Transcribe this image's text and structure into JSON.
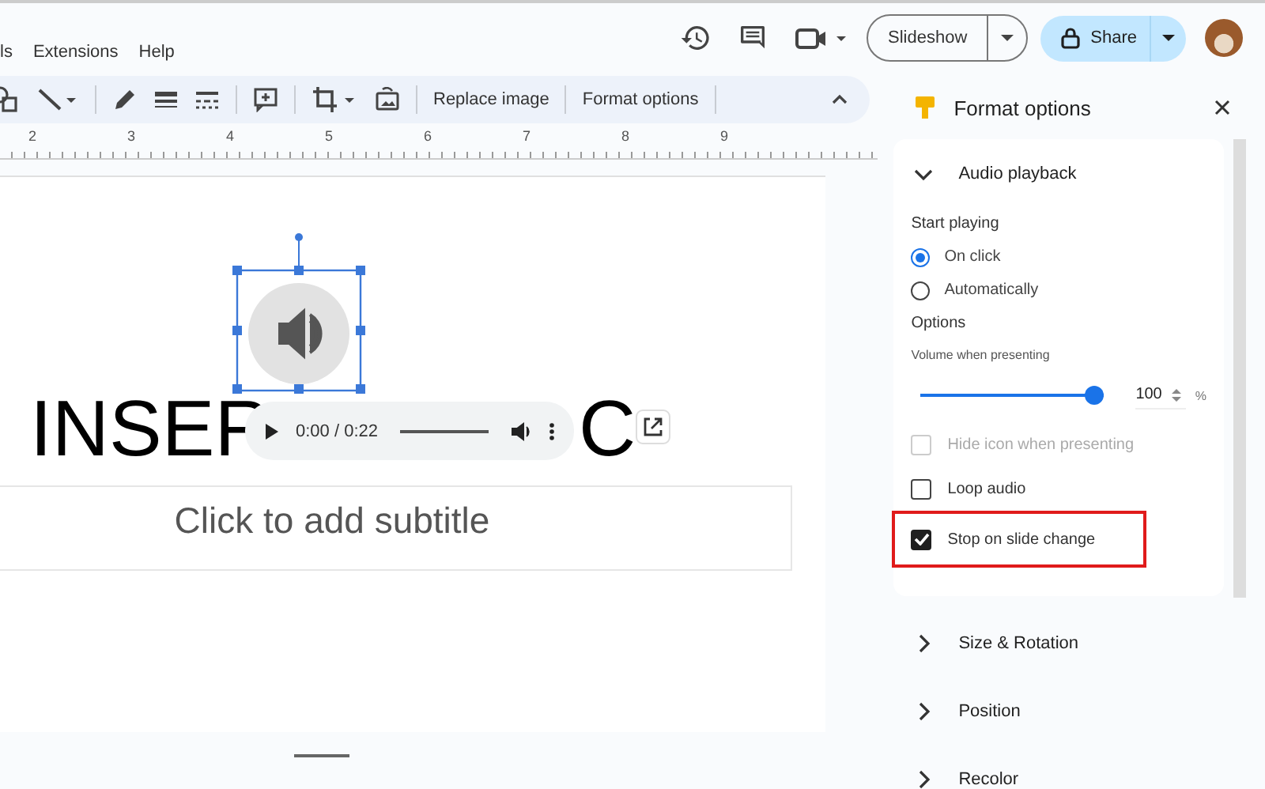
{
  "menu": [
    "ls",
    "Extensions",
    "Help"
  ],
  "header": {
    "slideshow": "Slideshow",
    "share": "Share"
  },
  "toolbar": {
    "buttons": [
      "Replace image",
      "Format options"
    ]
  },
  "ruler": [
    "2",
    "3",
    "4",
    "5",
    "6",
    "7",
    "8",
    "9"
  ],
  "slide": {
    "title_fragments": [
      "INSER",
      "C"
    ],
    "subtitle": "Click to add subtitle",
    "player_time": "0:00 / 0:22"
  },
  "panel": {
    "title": "Format options",
    "sections": [
      {
        "title": "Audio playback",
        "expanded": true,
        "start_playing": {
          "label": "Start playing",
          "options": [
            {
              "label": "On click",
              "selected": true
            },
            {
              "label": "Automatically",
              "selected": false
            }
          ]
        },
        "options_label": "Options",
        "volume_label": "Volume when presenting",
        "volume": {
          "level": 1,
          "value": "100",
          "unit": "%"
        },
        "checkboxes": [
          {
            "label": "Hide icon when presenting",
            "checked": false,
            "disabled": true,
            "highlighted": false
          },
          {
            "label": "Loop audio",
            "checked": false,
            "disabled": false,
            "highlighted": false
          },
          {
            "label": "Stop on slide change",
            "checked": true,
            "disabled": false,
            "highlighted": true
          }
        ]
      },
      {
        "title": "Size & Rotation",
        "expanded": false
      },
      {
        "title": "Position",
        "expanded": false
      },
      {
        "title": "Recolor",
        "expanded": false
      }
    ]
  }
}
